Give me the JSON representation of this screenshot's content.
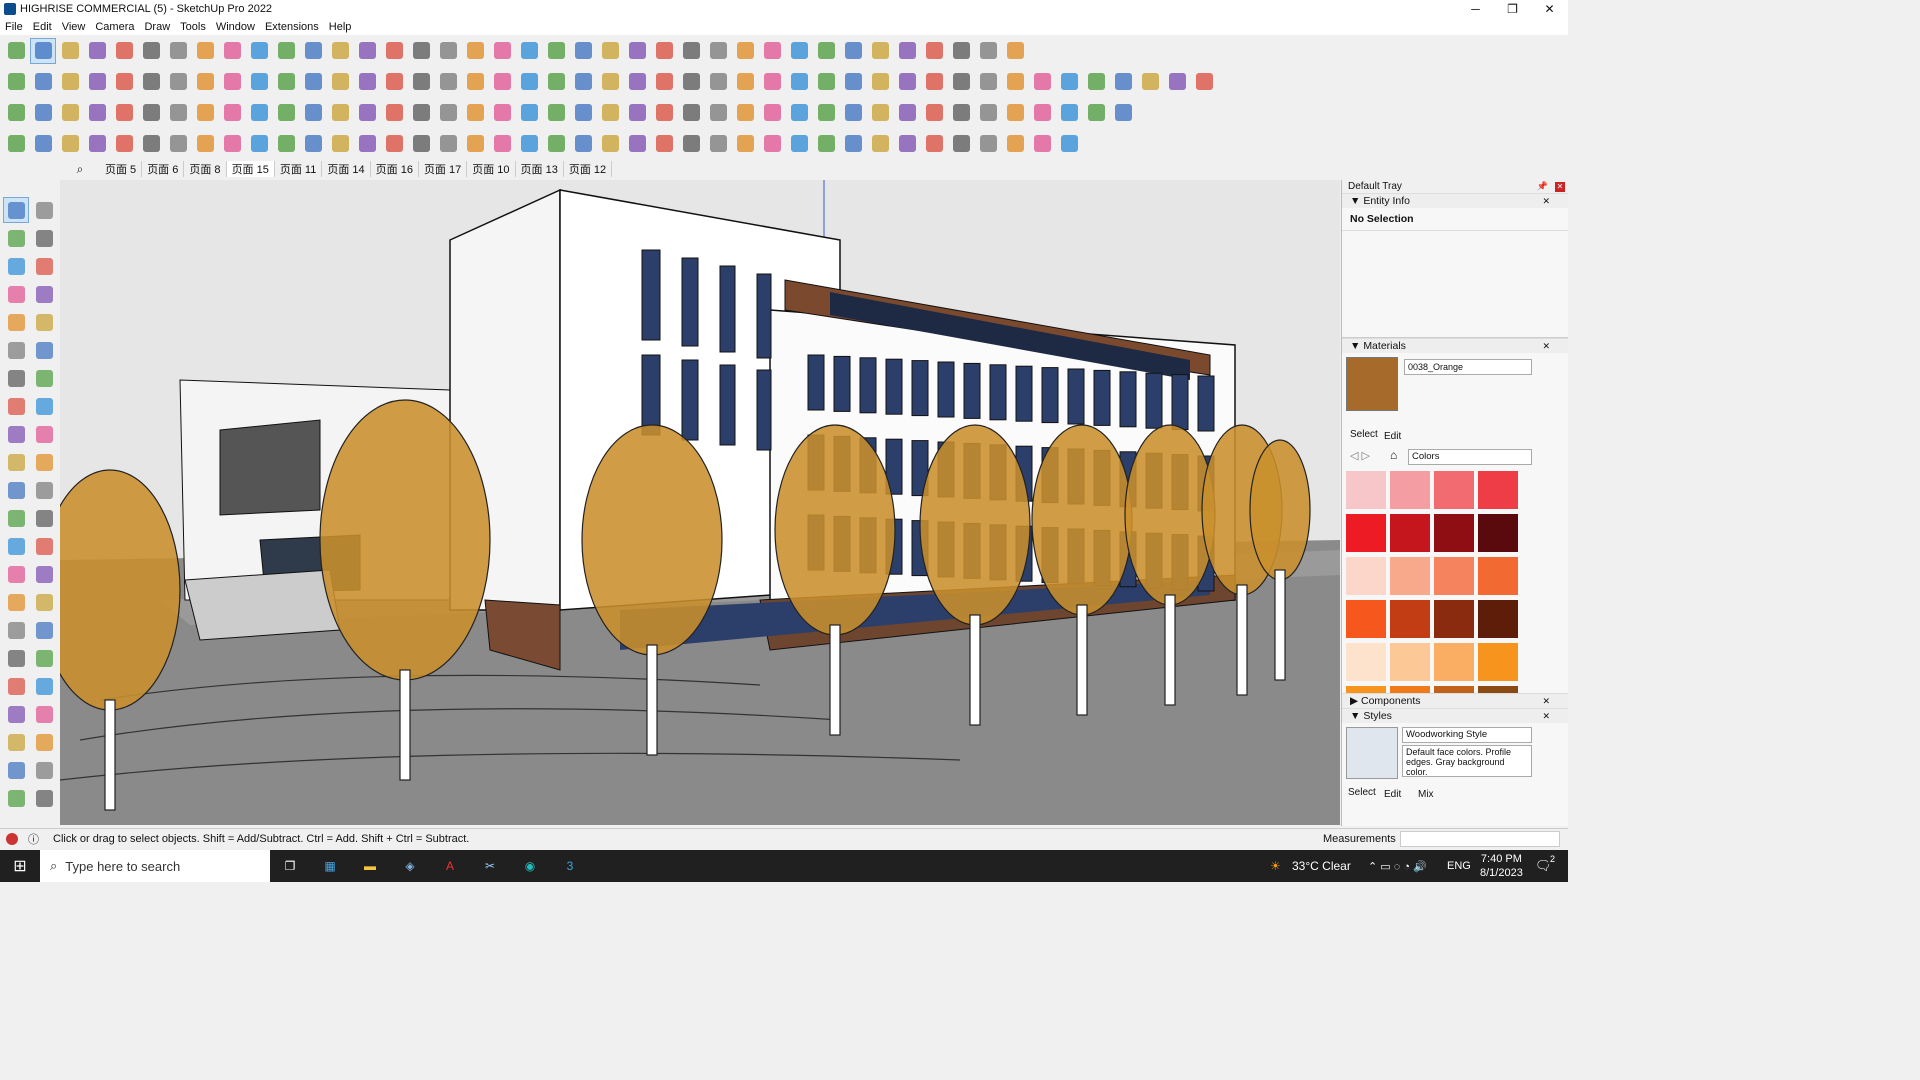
{
  "window": {
    "title": "HIGHRISE COMMERCIAL (5) - SketchUp Pro 2022",
    "minimize": "─",
    "restore": "❐",
    "close": "✕"
  },
  "menu": [
    "File",
    "Edit",
    "View",
    "Camera",
    "Draw",
    "Tools",
    "Window",
    "Extensions",
    "Help"
  ],
  "scenes": {
    "search_icon": "⌕",
    "tabs": [
      "页面 5",
      "页面 6",
      "页面 8",
      "页面 15",
      "页面 11",
      "页面 14",
      "页面 16",
      "页面 17",
      "页面 10",
      "页面 13",
      "页面 12"
    ],
    "selected": "页面 15"
  },
  "tray": {
    "title": "Default Tray",
    "entity_info": {
      "header": "Entity Info",
      "value": "No Selection"
    },
    "materials": {
      "header": "Materials",
      "name": "0038_Orange",
      "tab_select": "Select",
      "tab_edit": "Edit",
      "library": "Colors",
      "current_color": "#a66a2a",
      "colors": [
        "#f7c6c8",
        "#f49ea3",
        "#f26b70",
        "#ef3d47",
        "#ed1c24",
        "#c5151d",
        "#8e0e14",
        "#5a0a0c",
        "#fcd6c9",
        "#f8a88b",
        "#f5845e",
        "#f26a32",
        "#f5571c",
        "#c23c14",
        "#8a2a0e",
        "#5d1d09",
        "#fde3cc",
        "#fbc896",
        "#f9ae64",
        "#f7941d",
        "#f7941d",
        "#f07a1a",
        "#c2621a",
        "#8a4a12"
      ]
    },
    "components": {
      "header": "Components"
    },
    "styles": {
      "header": "Styles",
      "name": "Woodworking Style",
      "desc": "Default face colors. Profile edges. Gray background color.",
      "tab_select": "Select",
      "tab_edit": "Edit",
      "tab_mix": "Mix"
    }
  },
  "status": {
    "hint": "Click or drag to select objects. Shift = Add/Subtract. Ctrl = Add. Shift + Ctrl = Subtract.",
    "measurements_label": "Measurements"
  },
  "taskbar": {
    "search_placeholder": "Type here to search",
    "weather": "33°C  Clear",
    "lang": "ENG",
    "time": "7:40 PM",
    "date": "8/1/2023",
    "notif_count": "2"
  }
}
